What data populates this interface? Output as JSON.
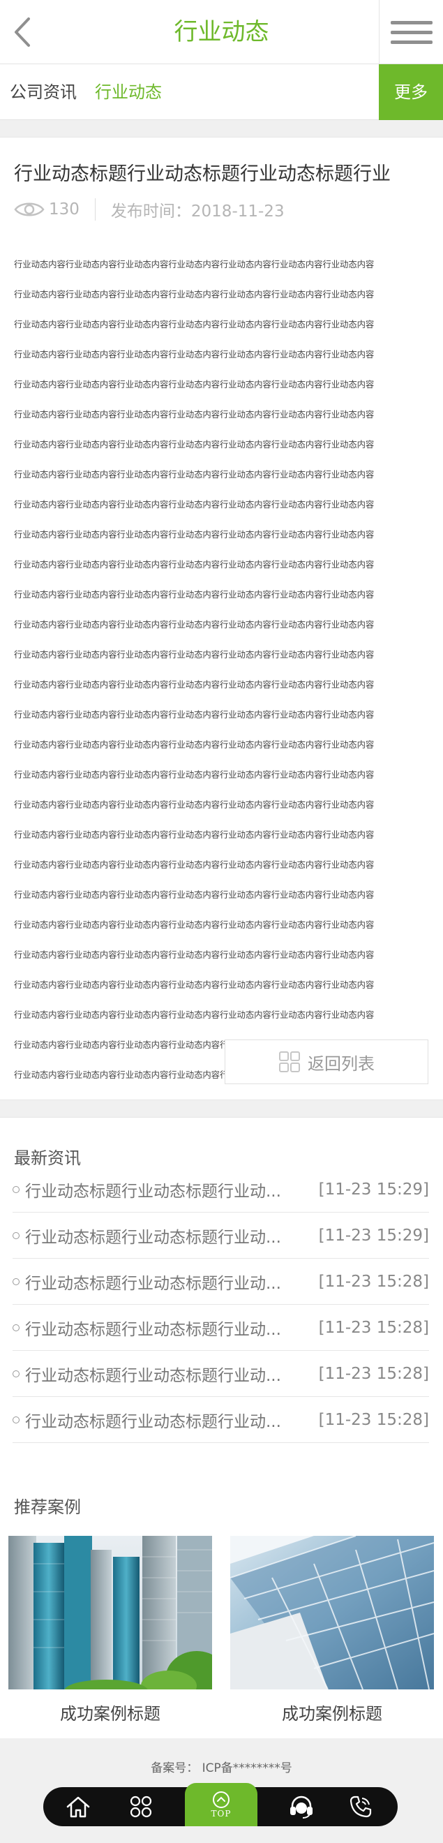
{
  "header": {
    "title": "行业动态",
    "back_icon": "chevron-left-icon",
    "menu_icon": "hamburger-icon"
  },
  "subnav": {
    "items": [
      "公司资讯",
      "行业动态"
    ],
    "active_index": 1,
    "more_label": "更多"
  },
  "article": {
    "title": "行业动态标题行业动态标题行业动态标题行业",
    "views": "130",
    "date_label": "发布时间：",
    "date": "2018-11-23",
    "body_lines": [
      "行业动态内容行业动态内容行业动态内容行业动态内容行业动态内容行业动态内容行业动态内容",
      "行业动态内容行业动态内容行业动态内容行业动态内容行业动态内容行业动态内容行业动态内容",
      "行业动态内容行业动态内容行业动态内容行业动态内容行业动态内容行业动态内容行业动态内容",
      "行业动态内容行业动态内容行业动态内容行业动态内容行业动态内容行业动态内容行业动态内容",
      "行业动态内容行业动态内容行业动态内容行业动态内容行业动态内容行业动态内容行业动态内容",
      "行业动态内容行业动态内容行业动态内容行业动态内容行业动态内容行业动态内容行业动态内容",
      "行业动态内容行业动态内容行业动态内容行业动态内容行业动态内容行业动态内容行业动态内容",
      "行业动态内容行业动态内容行业动态内容行业动态内容行业动态内容行业动态内容行业动态内容",
      "行业动态内容行业动态内容行业动态内容行业动态内容行业动态内容行业动态内容行业动态内容",
      "行业动态内容行业动态内容行业动态内容行业动态内容行业动态内容行业动态内容行业动态内容",
      "行业动态内容行业动态内容行业动态内容行业动态内容行业动态内容行业动态内容行业动态内容",
      "行业动态内容行业动态内容行业动态内容行业动态内容行业动态内容行业动态内容行业动态内容",
      "行业动态内容行业动态内容行业动态内容行业动态内容行业动态内容行业动态内容行业动态内容",
      "行业动态内容行业动态内容行业动态内容行业动态内容行业动态内容行业动态内容行业动态内容",
      "行业动态内容行业动态内容行业动态内容行业动态内容行业动态内容行业动态内容行业动态内容",
      "行业动态内容行业动态内容行业动态内容行业动态内容行业动态内容行业动态内容行业动态内容",
      "行业动态内容行业动态内容行业动态内容行业动态内容行业动态内容行业动态内容行业动态内容",
      "行业动态内容行业动态内容行业动态内容行业动态内容行业动态内容行业动态内容行业动态内容",
      "行业动态内容行业动态内容行业动态内容行业动态内容行业动态内容行业动态内容行业动态内容",
      "行业动态内容行业动态内容行业动态内容行业动态内容行业动态内容行业动态内容行业动态内容",
      "行业动态内容行业动态内容行业动态内容行业动态内容行业动态内容行业动态内容行业动态内容",
      "行业动态内容行业动态内容行业动态内容行业动态内容行业动态内容行业动态内容行业动态内容",
      "行业动态内容行业动态内容行业动态内容行业动态内容行业动态内容行业动态内容行业动态内容",
      "行业动态内容行业动态内容行业动态内容行业动态内容行业动态内容行业动态内容行业动态内容",
      "行业动态内容行业动态内容行业动态内容行业动态内容行业动态内容行业动态内容行业动态内容",
      "行业动态内容行业动态内容行业动态内容行业动态内容行业动态内容行业动态内容行业动态内容",
      "行业动态内容行业动态内容行业动态内容行业动态内容行业动态内容行业动态内容行业动态内容",
      "行业动态内容行业动态内容行业动态内容行业动态内容行业动态内容"
    ],
    "return_label": "返回列表",
    "return_icon": "grid-icon"
  },
  "latest": {
    "title": "最新资讯",
    "items": [
      {
        "title": "行业动态标题行业动态标题行业动...",
        "time": "[11-23 15:29]"
      },
      {
        "title": "行业动态标题行业动态标题行业动...",
        "time": "[11-23 15:29]"
      },
      {
        "title": "行业动态标题行业动态标题行业动...",
        "time": "[11-23 15:28]"
      },
      {
        "title": "行业动态标题行业动态标题行业动...",
        "time": "[11-23 15:28]"
      },
      {
        "title": "行业动态标题行业动态标题行业动...",
        "time": "[11-23 15:28]"
      },
      {
        "title": "行业动态标题行业动态标题行业动...",
        "time": "[11-23 15:28]"
      }
    ]
  },
  "cases": {
    "title": "推荐案例",
    "items": [
      {
        "caption": "成功案例标题"
      },
      {
        "caption": "成功案例标题"
      }
    ]
  },
  "footer": {
    "record_label": "备案号：",
    "record_value": "ICP备********号",
    "bottom_nav": [
      {
        "icon": "home-icon"
      },
      {
        "icon": "apps-icon"
      },
      {
        "icon": "arrow-up-circle-icon",
        "label": "TOP"
      },
      {
        "icon": "headset-icon"
      },
      {
        "icon": "phone-icon"
      }
    ]
  },
  "colors": {
    "accent": "#6eb92b",
    "bar": "#101010",
    "background": "#f0f0f0"
  }
}
